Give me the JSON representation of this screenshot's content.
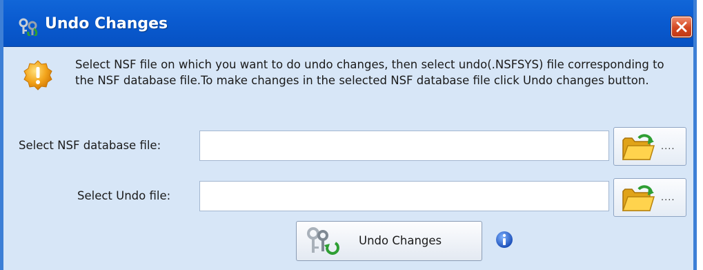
{
  "window": {
    "title": "Undo Changes",
    "icons": {
      "title": "keys-icon",
      "close": "close-icon"
    }
  },
  "message": {
    "icon": "warning-icon",
    "text": "Select NSF file on which you want to do undo changes, then select undo(.NSFSYS) file corresponding to the NSF database file.To make changes in the selected NSF database file click Undo changes button."
  },
  "nsf_row": {
    "label": "Select NSF database file:",
    "value": "",
    "browse_label": "....",
    "browse_icon": "open-folder-icon"
  },
  "undo_row": {
    "label": "Select Undo file:",
    "value": "",
    "browse_label": "....",
    "browse_icon": "open-folder-icon"
  },
  "action": {
    "label": "Undo Changes",
    "icon": "keys-undo-icon",
    "help_icon": "info-icon"
  },
  "colors": {
    "titlebar": "#0a5bd0",
    "frame": "#3d7fd6",
    "background": "#d7e6f7",
    "close": "#d34620"
  }
}
